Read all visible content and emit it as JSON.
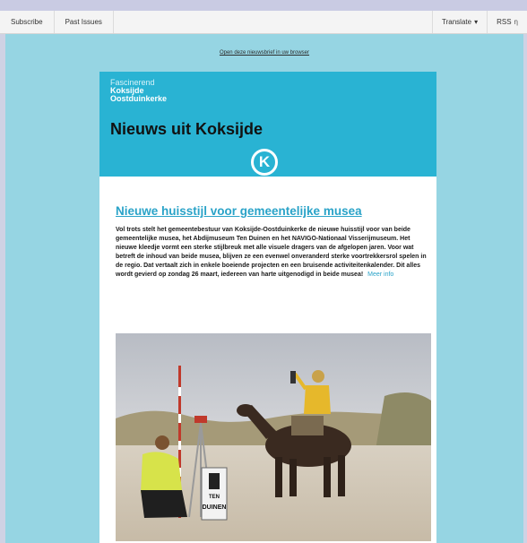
{
  "toolbar": {
    "subscribe": "Subscribe",
    "past_issues": "Past Issues",
    "translate": "Translate",
    "translate_arrow": "▾",
    "rss": "RSS",
    "rss_glyph": "ƞ"
  },
  "email": {
    "browser_link": "Open deze nieuwsbrief in uw browser",
    "logo": {
      "line1": "Fascinerend",
      "line2": "Koksijde",
      "line3": "Oostduinkerke"
    },
    "header_title": "Nieuws uit Koksijde",
    "logo_letter": "K",
    "article": {
      "title": "Nieuwe huisstijl voor gemeentelijke musea",
      "body": "Vol trots stelt het gemeentebestuur van Koksijde-Oostduinkerke de nieuwe huisstijl voor van beide gemeentelijke musea, het Abdijmuseum Ten Duinen en het NAVIGO-Nationaal Visserijmuseum. Het nieuwe kleedje vormt een sterke stijlbreuk met alle visuele dragers van de afgelopen jaren. Voor wat betreft de inhoud van beide musea, blijven ze een evenwel onveranderd sterke voortrekkersrol spelen in de regio. Dat vertaalt zich in enkele boeiende projecten en een bruisende activiteitenkalender. Dit alles wordt gevierd op zondag 26 maart, iedereen van harte uitgenodigd in beide musea!",
      "more_link": "Meer info",
      "sign_line1": "TEN",
      "sign_line2": "DUINEN"
    }
  },
  "colors": {
    "page_bg": "#96d5e3",
    "header_bg": "#29b3d3",
    "link": "#2aa3c8"
  }
}
